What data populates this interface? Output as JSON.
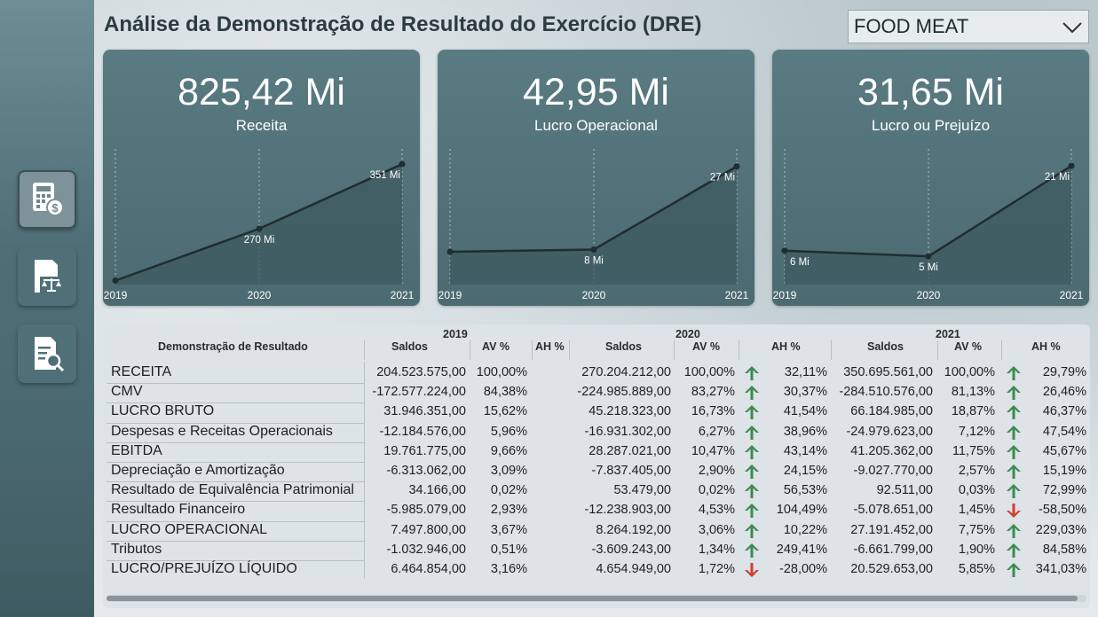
{
  "title": "Análise da Demonstração de Resultado do Exercício (DRE)",
  "slicer": {
    "selected": "FOOD MEAT"
  },
  "nav": [
    {
      "icon": "calculator-dollar-icon"
    },
    {
      "icon": "document-scale-icon"
    },
    {
      "icon": "document-search-icon"
    }
  ],
  "colors": {
    "up": "#3c8a50",
    "down": "#d23b34",
    "card": "#527178"
  },
  "cards": [
    {
      "value": "825,42 Mi",
      "label": "Receita"
    },
    {
      "value": "42,95 Mi",
      "label": "Lucro Operacional"
    },
    {
      "value": "31,65 Mi",
      "label": "Lucro ou Prejuízo"
    }
  ],
  "chart_data": [
    {
      "type": "area",
      "x": [
        "2019",
        "2020",
        "2021"
      ],
      "values": [
        205,
        270,
        351
      ],
      "data_labels": [
        "",
        "270 Mi",
        "351 Mi"
      ],
      "ylim": [
        200,
        370
      ]
    },
    {
      "type": "area",
      "x": [
        "2019",
        "2020",
        "2021"
      ],
      "values": [
        7.5,
        8,
        27
      ],
      "data_labels": [
        "",
        "8 Mi",
        "27 Mi"
      ],
      "ylim": [
        0,
        31
      ]
    },
    {
      "type": "area",
      "x": [
        "2019",
        "2020",
        "2021"
      ],
      "values": [
        6,
        5,
        21
      ],
      "data_labels": [
        "6 Mi",
        "5 Mi",
        "21 Mi"
      ],
      "ylim": [
        0,
        24
      ]
    }
  ],
  "table": {
    "row_header": "Demonstração de Resultado",
    "years": [
      "2019",
      "2020",
      "2021"
    ],
    "col_saldos": "Saldos",
    "col_av": "AV %",
    "col_ah": "AH %",
    "rows": [
      {
        "label": "RECEITA",
        "y2019": [
          "204.523.575,00",
          "100,00%",
          ""
        ],
        "y2020": [
          "270.204.212,00",
          "100,00%",
          "32,11%",
          "up"
        ],
        "y2021": [
          "350.695.561,00",
          "100,00%",
          "29,79%",
          "up"
        ]
      },
      {
        "label": "CMV",
        "y2019": [
          "-172.577.224,00",
          "84,38%",
          ""
        ],
        "y2020": [
          "-224.985.889,00",
          "83,27%",
          "30,37%",
          "up"
        ],
        "y2021": [
          "-284.510.576,00",
          "81,13%",
          "26,46%",
          "up"
        ]
      },
      {
        "label": "LUCRO BRUTO",
        "y2019": [
          "31.946.351,00",
          "15,62%",
          ""
        ],
        "y2020": [
          "45.218.323,00",
          "16,73%",
          "41,54%",
          "up"
        ],
        "y2021": [
          "66.184.985,00",
          "18,87%",
          "46,37%",
          "up"
        ]
      },
      {
        "label": "Despesas e Receitas Operacionais",
        "y2019": [
          "-12.184.576,00",
          "5,96%",
          ""
        ],
        "y2020": [
          "-16.931.302,00",
          "6,27%",
          "38,96%",
          "up"
        ],
        "y2021": [
          "-24.979.623,00",
          "7,12%",
          "47,54%",
          "up"
        ]
      },
      {
        "label": "EBITDA",
        "y2019": [
          "19.761.775,00",
          "9,66%",
          ""
        ],
        "y2020": [
          "28.287.021,00",
          "10,47%",
          "43,14%",
          "up"
        ],
        "y2021": [
          "41.205.362,00",
          "11,75%",
          "45,67%",
          "up"
        ]
      },
      {
        "label": "Depreciação e Amortização",
        "y2019": [
          "-6.313.062,00",
          "3,09%",
          ""
        ],
        "y2020": [
          "-7.837.405,00",
          "2,90%",
          "24,15%",
          "up"
        ],
        "y2021": [
          "-9.027.770,00",
          "2,57%",
          "15,19%",
          "up"
        ]
      },
      {
        "label": "Resultado de Equivalência Patrimonial",
        "y2019": [
          "34.166,00",
          "0,02%",
          ""
        ],
        "y2020": [
          "53.479,00",
          "0,02%",
          "56,53%",
          "up"
        ],
        "y2021": [
          "92.511,00",
          "0,03%",
          "72,99%",
          "up"
        ]
      },
      {
        "label": "Resultado Financeiro",
        "y2019": [
          "-5.985.079,00",
          "2,93%",
          ""
        ],
        "y2020": [
          "-12.238.903,00",
          "4,53%",
          "104,49%",
          "up"
        ],
        "y2021": [
          "-5.078.651,00",
          "1,45%",
          "-58,50%",
          "down"
        ]
      },
      {
        "label": "LUCRO OPERACIONAL",
        "y2019": [
          "7.497.800,00",
          "3,67%",
          ""
        ],
        "y2020": [
          "8.264.192,00",
          "3,06%",
          "10,22%",
          "up"
        ],
        "y2021": [
          "27.191.452,00",
          "7,75%",
          "229,03%",
          "up"
        ]
      },
      {
        "label": "Tributos",
        "y2019": [
          "-1.032.946,00",
          "0,51%",
          ""
        ],
        "y2020": [
          "-3.609.243,00",
          "1,34%",
          "249,41%",
          "up"
        ],
        "y2021": [
          "-6.661.799,00",
          "1,90%",
          "84,58%",
          "up"
        ]
      },
      {
        "label": "LUCRO/PREJUÍZO LÍQUIDO",
        "y2019": [
          "6.464.854,00",
          "3,16%",
          ""
        ],
        "y2020": [
          "4.654.949,00",
          "1,72%",
          "-28,00%",
          "down"
        ],
        "y2021": [
          "20.529.653,00",
          "5,85%",
          "341,03%",
          "up"
        ]
      }
    ]
  }
}
